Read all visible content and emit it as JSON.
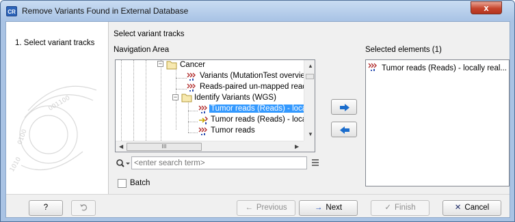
{
  "window": {
    "title": "Remove Variants Found in External Database",
    "app_icon_text": "CR",
    "close_glyph": "x"
  },
  "steps": [
    {
      "label": "1.  Select variant tracks"
    }
  ],
  "main": {
    "section_title": "Select variant tracks",
    "navigation_label": "Navigation Area",
    "selected_label": "Selected elements (1)",
    "tree": [
      {
        "label": "Cancer",
        "icon": "folder-icon",
        "expander": "minus"
      },
      {
        "label": "Variants (MutationTest overview,",
        "icon": "variant-track-icon"
      },
      {
        "label": "Reads-paired un-mapped reads [",
        "icon": "variant-track-icon"
      },
      {
        "label": "Identify Variants (WGS)",
        "icon": "folder-icon",
        "expander": "minus"
      },
      {
        "label": "Tumor reads (Reads) - locally",
        "icon": "variant-track-icon",
        "selected": true
      },
      {
        "label": "Tumor reads (Reads) - locally",
        "icon": "variant-track-yellow-icon"
      },
      {
        "label": "Tumor reads",
        "icon": "variant-track-icon"
      }
    ],
    "hscroll_thumb_glyph": "III",
    "search": {
      "placeholder": "<enter search term>",
      "value": ""
    },
    "batch_label": "Batch",
    "batch_checked": false,
    "selected_items": [
      {
        "label": "Tumor reads (Reads) - locally real...",
        "icon": "variant-track-icon"
      }
    ]
  },
  "footer": {
    "help_label": "?",
    "previous_label": "Previous",
    "next_label": "Next",
    "finish_label": "Finish",
    "cancel_label": "Cancel"
  },
  "colors": {
    "selection": "#3399ff",
    "next_arrow": "#1a49b8",
    "cancel_x": "#1c2a66",
    "finish_check": "#8d8d8d"
  }
}
